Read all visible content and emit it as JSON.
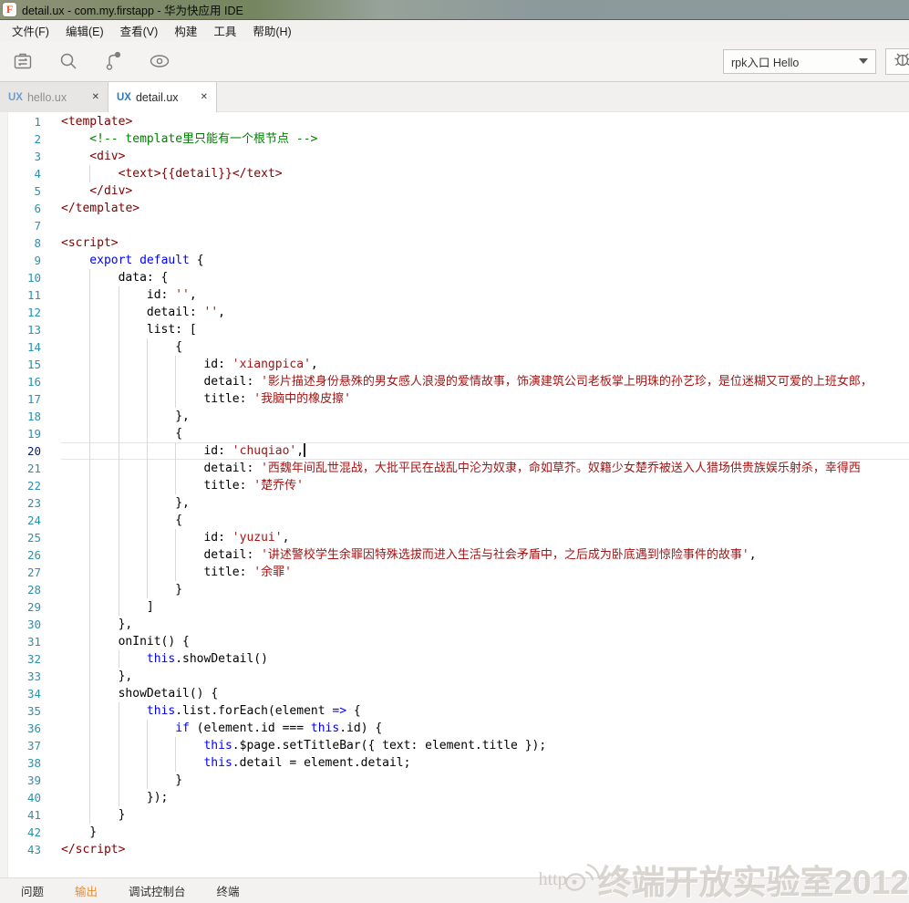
{
  "window": {
    "title": "detail.ux - com.my.firstapp - 华为快应用 IDE",
    "icon_letter": "F"
  },
  "menu": {
    "items": [
      "文件(F)",
      "编辑(E)",
      "查看(V)",
      "构建",
      "工具",
      "帮助(H)"
    ]
  },
  "toolbar": {
    "left_icons": [
      "project-icon",
      "search-icon",
      "git-branch-icon",
      "preview-eye-icon"
    ],
    "entry_select": {
      "value": "rpk入口 Hello"
    },
    "debug_icon": "bug-icon"
  },
  "tabs": [
    {
      "type": "UX",
      "label": "hello.ux",
      "close": "✕",
      "active": false
    },
    {
      "type": "UX",
      "label": "detail.ux",
      "close": "✕",
      "active": true
    }
  ],
  "colors": {
    "accent_orange": "#e78a33",
    "tab_type_blue": "#2e79c0",
    "syntax_tag": "#800000",
    "syntax_string": "#a31515",
    "syntax_keyword": "#0000ff",
    "syntax_comment": "#008000",
    "line_number": "#2b91af"
  },
  "editor": {
    "lines": [
      {
        "n": 1,
        "indent": 0,
        "segs": [
          {
            "c": "tag",
            "t": "<template>"
          }
        ]
      },
      {
        "n": 2,
        "indent": 1,
        "segs": [
          {
            "c": "com",
            "t": "<!-- template里只能有一个根节点 -->"
          }
        ]
      },
      {
        "n": 3,
        "indent": 1,
        "segs": [
          {
            "c": "tag",
            "t": "<div>"
          }
        ]
      },
      {
        "n": 4,
        "indent": 2,
        "segs": [
          {
            "c": "tag",
            "t": "<text>{{detail}}</text>"
          }
        ]
      },
      {
        "n": 5,
        "indent": 1,
        "segs": [
          {
            "c": "tag",
            "t": "</div>"
          }
        ]
      },
      {
        "n": 6,
        "indent": 0,
        "segs": [
          {
            "c": "tag",
            "t": "</template>"
          }
        ]
      },
      {
        "n": 7,
        "indent": 0,
        "segs": []
      },
      {
        "n": 8,
        "indent": 0,
        "segs": [
          {
            "c": "tag",
            "t": "<script>"
          }
        ]
      },
      {
        "n": 9,
        "indent": 1,
        "segs": [
          {
            "c": "kw",
            "t": "export"
          },
          {
            "c": "pl",
            "t": " "
          },
          {
            "c": "kw",
            "t": "default"
          },
          {
            "c": "pl",
            "t": " {"
          }
        ]
      },
      {
        "n": 10,
        "indent": 2,
        "segs": [
          {
            "c": "pl",
            "t": "data: {"
          }
        ]
      },
      {
        "n": 11,
        "indent": 3,
        "segs": [
          {
            "c": "pl",
            "t": "id: "
          },
          {
            "c": "str",
            "t": "''"
          },
          {
            "c": "pl",
            "t": ","
          }
        ]
      },
      {
        "n": 12,
        "indent": 3,
        "segs": [
          {
            "c": "pl",
            "t": "detail: "
          },
          {
            "c": "str",
            "t": "''"
          },
          {
            "c": "pl",
            "t": ","
          }
        ]
      },
      {
        "n": 13,
        "indent": 3,
        "segs": [
          {
            "c": "pl",
            "t": "list: ["
          }
        ]
      },
      {
        "n": 14,
        "indent": 4,
        "segs": [
          {
            "c": "pl",
            "t": "{"
          }
        ]
      },
      {
        "n": 15,
        "indent": 5,
        "segs": [
          {
            "c": "pl",
            "t": "id: "
          },
          {
            "c": "str",
            "t": "'xiangpica'"
          },
          {
            "c": "pl",
            "t": ","
          }
        ]
      },
      {
        "n": 16,
        "indent": 5,
        "segs": [
          {
            "c": "pl",
            "t": "detail: "
          },
          {
            "c": "str",
            "t": "'影片描述身份悬殊的男女感人浪漫的爱情故事，饰演建筑公司老板掌上明珠的孙艺珍，是位迷糊又可爱的上班女郎，"
          }
        ]
      },
      {
        "n": 17,
        "indent": 5,
        "segs": [
          {
            "c": "pl",
            "t": "title: "
          },
          {
            "c": "str",
            "t": "'我脑中的橡皮擦'"
          }
        ]
      },
      {
        "n": 18,
        "indent": 4,
        "segs": [
          {
            "c": "pl",
            "t": "},"
          }
        ]
      },
      {
        "n": 19,
        "indent": 4,
        "segs": [
          {
            "c": "pl",
            "t": "{"
          }
        ]
      },
      {
        "n": 20,
        "indent": 5,
        "current": true,
        "cursor": true,
        "segs": [
          {
            "c": "pl",
            "t": "id: "
          },
          {
            "c": "str",
            "t": "'chuqiao'"
          },
          {
            "c": "pl",
            "t": ","
          }
        ]
      },
      {
        "n": 21,
        "indent": 5,
        "segs": [
          {
            "c": "pl",
            "t": "detail: "
          },
          {
            "c": "str",
            "t": "'西魏年间乱世混战，大批平民在战乱中沦为奴隶，命如草芥。奴籍少女楚乔被送入人猎场供贵族娱乐射杀，幸得西"
          }
        ]
      },
      {
        "n": 22,
        "indent": 5,
        "segs": [
          {
            "c": "pl",
            "t": "title: "
          },
          {
            "c": "str",
            "t": "'楚乔传'"
          }
        ]
      },
      {
        "n": 23,
        "indent": 4,
        "segs": [
          {
            "c": "pl",
            "t": "},"
          }
        ]
      },
      {
        "n": 24,
        "indent": 4,
        "segs": [
          {
            "c": "pl",
            "t": "{"
          }
        ]
      },
      {
        "n": 25,
        "indent": 5,
        "segs": [
          {
            "c": "pl",
            "t": "id: "
          },
          {
            "c": "str",
            "t": "'yuzui'"
          },
          {
            "c": "pl",
            "t": ","
          }
        ]
      },
      {
        "n": 26,
        "indent": 5,
        "segs": [
          {
            "c": "pl",
            "t": "detail: "
          },
          {
            "c": "str",
            "t": "'讲述警校学生余罪因特殊选拔而进入生活与社会矛盾中，之后成为卧底遇到惊险事件的故事'"
          },
          {
            "c": "pl",
            "t": ","
          }
        ]
      },
      {
        "n": 27,
        "indent": 5,
        "segs": [
          {
            "c": "pl",
            "t": "title: "
          },
          {
            "c": "str",
            "t": "'余罪'"
          }
        ]
      },
      {
        "n": 28,
        "indent": 4,
        "segs": [
          {
            "c": "pl",
            "t": "}"
          }
        ]
      },
      {
        "n": 29,
        "indent": 3,
        "segs": [
          {
            "c": "pl",
            "t": "]"
          }
        ]
      },
      {
        "n": 30,
        "indent": 2,
        "segs": [
          {
            "c": "pl",
            "t": "},"
          }
        ]
      },
      {
        "n": 31,
        "indent": 2,
        "segs": [
          {
            "c": "pl",
            "t": "onInit() {"
          }
        ]
      },
      {
        "n": 32,
        "indent": 3,
        "segs": [
          {
            "c": "kw",
            "t": "this"
          },
          {
            "c": "pl",
            "t": ".showDetail()"
          }
        ]
      },
      {
        "n": 33,
        "indent": 2,
        "segs": [
          {
            "c": "pl",
            "t": "},"
          }
        ]
      },
      {
        "n": 34,
        "indent": 2,
        "segs": [
          {
            "c": "pl",
            "t": "showDetail() {"
          }
        ]
      },
      {
        "n": 35,
        "indent": 3,
        "segs": [
          {
            "c": "kw",
            "t": "this"
          },
          {
            "c": "pl",
            "t": ".list.forEach(element "
          },
          {
            "c": "kw",
            "t": "=>"
          },
          {
            "c": "pl",
            "t": " {"
          }
        ]
      },
      {
        "n": 36,
        "indent": 4,
        "segs": [
          {
            "c": "kw",
            "t": "if"
          },
          {
            "c": "pl",
            "t": " (element.id === "
          },
          {
            "c": "kw",
            "t": "this"
          },
          {
            "c": "pl",
            "t": ".id) {"
          }
        ]
      },
      {
        "n": 37,
        "indent": 5,
        "segs": [
          {
            "c": "kw",
            "t": "this"
          },
          {
            "c": "pl",
            "t": ".$page.setTitleBar({ text: element.title });"
          }
        ]
      },
      {
        "n": 38,
        "indent": 5,
        "segs": [
          {
            "c": "kw",
            "t": "this"
          },
          {
            "c": "pl",
            "t": ".detail = element.detail;"
          }
        ]
      },
      {
        "n": 39,
        "indent": 4,
        "segs": [
          {
            "c": "pl",
            "t": "}"
          }
        ]
      },
      {
        "n": 40,
        "indent": 3,
        "segs": [
          {
            "c": "pl",
            "t": "});"
          }
        ]
      },
      {
        "n": 41,
        "indent": 2,
        "segs": [
          {
            "c": "pl",
            "t": "}"
          }
        ]
      },
      {
        "n": 42,
        "indent": 1,
        "segs": [
          {
            "c": "pl",
            "t": "}"
          }
        ]
      },
      {
        "n": 43,
        "indent": 0,
        "segs": [
          {
            "c": "tag",
            "t": "</script>"
          }
        ]
      }
    ]
  },
  "panel": {
    "tabs": [
      {
        "label": "问题",
        "active": false
      },
      {
        "label": "输出",
        "active": true
      },
      {
        "label": "调试控制台",
        "active": false
      },
      {
        "label": "终端",
        "active": false
      }
    ]
  },
  "watermark": {
    "prefix": "http",
    "text": "终端开放实验室2012"
  }
}
